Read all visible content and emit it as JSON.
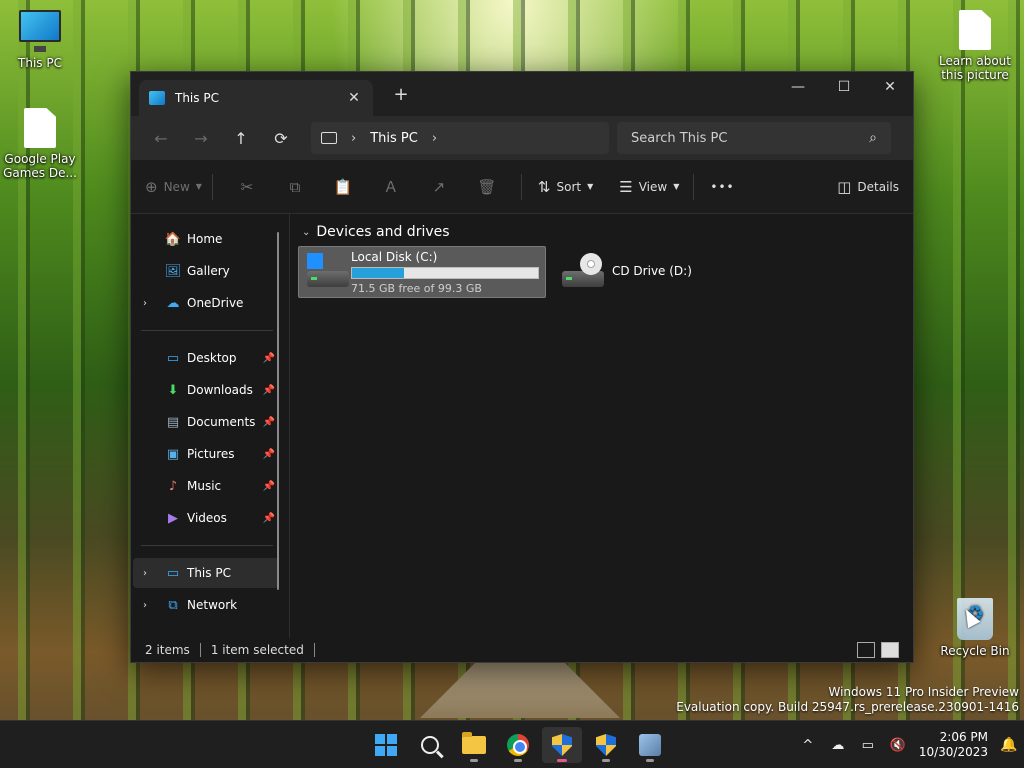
{
  "desktop": {
    "icons": [
      {
        "label": "This PC"
      },
      {
        "label": "Google Play Games De..."
      },
      {
        "label": "Learn about this picture"
      },
      {
        "label": "Recycle Bin"
      }
    ],
    "watermark": {
      "line1": "Windows 11 Pro Insider Preview",
      "line2": "Evaluation copy. Build 25947.rs_prerelease.230901-1416"
    }
  },
  "explorer": {
    "tab": {
      "title": "This PC",
      "close": "✕",
      "icon": "monitor-icon"
    },
    "new_tab": "+",
    "window_controls": {
      "minimize": "—",
      "maximize": "☐",
      "close": "✕"
    },
    "nav": {
      "back": "←",
      "forward": "→",
      "up": "↑",
      "refresh": "⟳"
    },
    "address": {
      "chevron1": "›",
      "crumb": "This PC",
      "chevron2": "›"
    },
    "search": {
      "placeholder": "Search This PC",
      "icon": "⌕"
    },
    "toolbar": {
      "new_label": "New",
      "sort_label": "Sort",
      "view_label": "View",
      "more": "•••",
      "details_label": "Details"
    },
    "sidebar": {
      "items": [
        {
          "label": "Home",
          "icon": "🏠"
        },
        {
          "label": "Gallery",
          "icon": "🖼"
        },
        {
          "label": "OneDrive",
          "icon": "☁"
        },
        {
          "label": "Desktop",
          "icon": "▭"
        },
        {
          "label": "Downloads",
          "icon": "⬇"
        },
        {
          "label": "Documents",
          "icon": "▤"
        },
        {
          "label": "Pictures",
          "icon": "▣"
        },
        {
          "label": "Music",
          "icon": "♪"
        },
        {
          "label": "Videos",
          "icon": "▶"
        },
        {
          "label": "This PC",
          "icon": "▭"
        },
        {
          "label": "Network",
          "icon": "⧉"
        }
      ],
      "chevron": "›",
      "pin": "📌"
    },
    "content": {
      "group_title": "Devices and drives",
      "caret": "⌄",
      "drives": [
        {
          "name": "Local Disk (C:)",
          "free_text": "71.5 GB free of 99.3 GB",
          "used_fraction": 0.28
        },
        {
          "name": "CD Drive (D:)"
        }
      ]
    },
    "status": {
      "items": "2 items",
      "selected": "1 item selected"
    }
  },
  "taskbar": {
    "tray": {
      "chevron": "^",
      "time": "2:06 PM",
      "date": "10/30/2023"
    }
  },
  "colors": {
    "accent": "#26a0da",
    "window_bg": "#191919",
    "titlebar_bg": "#202020"
  }
}
